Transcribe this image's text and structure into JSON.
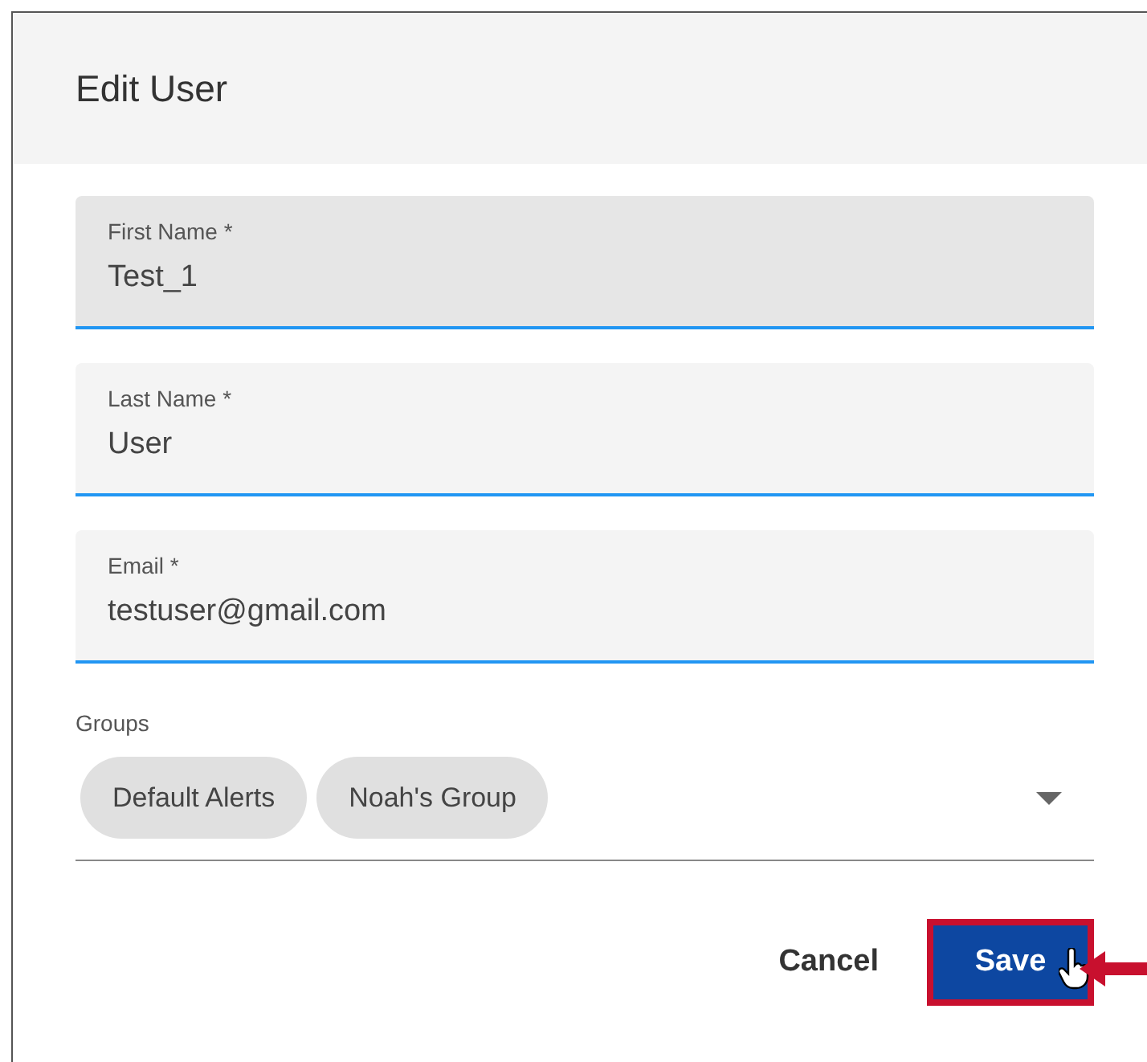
{
  "dialog": {
    "title": "Edit User"
  },
  "fields": [
    {
      "label": "First Name *",
      "value": "Test_1",
      "hovered": true
    },
    {
      "label": "Last Name *",
      "value": "User",
      "hovered": false
    },
    {
      "label": "Email *",
      "value": "testuser@gmail.com",
      "hovered": false
    }
  ],
  "groups": {
    "label": "Groups",
    "chips": [
      "Default Alerts",
      "Noah's Group"
    ]
  },
  "buttons": [
    {
      "label": "Cancel",
      "kind": "text",
      "highlighted": false
    },
    {
      "label": "Save",
      "kind": "primary",
      "highlighted": true
    }
  ]
}
